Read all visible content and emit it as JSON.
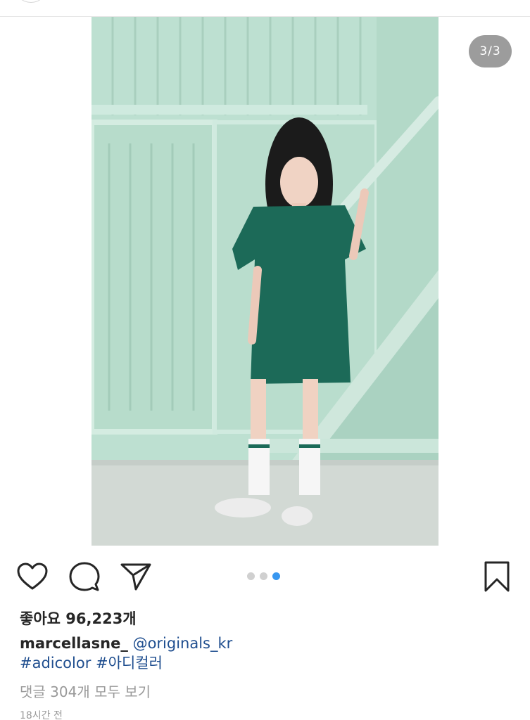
{
  "post": {
    "image_counter": "3/3",
    "carousel": {
      "total": 3,
      "active_index": 2
    },
    "likes_text": "좋아요 96,223개",
    "username": "marcellasne_",
    "mention": "@originals_kr",
    "hashtags": [
      "#adicolor",
      "#아디컬러"
    ],
    "view_comments": "댓글 304개 모두 보기",
    "timestamp": "18시간 전"
  },
  "icons": {
    "like": "heart-icon",
    "comment": "comment-icon",
    "share": "send-icon",
    "save": "bookmark-icon"
  },
  "colors": {
    "dot_active": "#3897f0",
    "dot_inactive": "#d0d0d0",
    "link": "#1f4e8f",
    "counter_bg": "#9c9c9c"
  }
}
